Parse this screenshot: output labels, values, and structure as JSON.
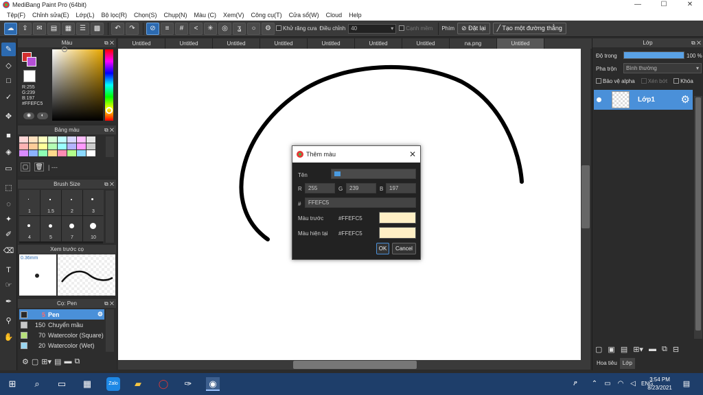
{
  "window": {
    "title": "MediBang Paint Pro (64bit)",
    "minimize": "—",
    "maximize": "☐",
    "close": "✕"
  },
  "menu": [
    "Tệp(F)",
    "Chỉnh sửa(E)",
    "Lớp(L)",
    "Bộ lọc(R)",
    "Chọn(S)",
    "Chụp(N)",
    "Màu (C)",
    "Xem(V)",
    "Công cụ(T)",
    "Cửa sổ(W)",
    "Cloud",
    "Help"
  ],
  "toolbar": {
    "antialias_label": "Khử răng cưa",
    "adjust_label": "Điều chỉnh",
    "adjust_value": "40",
    "edge_label": "Cạnh mềm",
    "key_label": "Phím",
    "reset_label": "Đặt lại",
    "straight_label": "Tạo một đường thẳng"
  },
  "color_panel": {
    "title": "Màu",
    "r": "R:255",
    "g": "G:239",
    "b": "B:197",
    "hex": "#FFEFC5",
    "fg_color": "#d32f2f",
    "bg_color": "#ffffff"
  },
  "palette_panel": {
    "title": "Bảng màu",
    "status": "| ---"
  },
  "palette_colors": [
    "#ffd7d7",
    "#ffe1bf",
    "#ffffbf",
    "#d7ffd7",
    "#bfffff",
    "#d7d7ff",
    "#ffbfff",
    "#e6e6e6",
    "#ffb3b3",
    "#ffcc99",
    "#ffff99",
    "#b3ffb3",
    "#99ffff",
    "#b3b3ff",
    "#ff99ff",
    "#cccccc",
    "#d98cff",
    "#8cb3ff",
    "#8cffb3",
    "#ffd98c",
    "#ff8cb3",
    "#b3ff8c",
    "#8cd9ff",
    "#ffffff"
  ],
  "brush_panel": {
    "title": "Brush Size",
    "sizes": [
      "1",
      "1.5",
      "2",
      "3",
      "4",
      "5",
      "7",
      "10"
    ]
  },
  "preview_panel": {
    "title": "Xem trước cọ",
    "size": "0.36mm"
  },
  "brush_list": {
    "title": "Cọ: Pen",
    "items": [
      {
        "size": "5",
        "name": "Pen",
        "color": "#2a2a2a"
      },
      {
        "size": "150",
        "name": "Chuyển mầu",
        "color": "#c8c8c8"
      },
      {
        "size": "70",
        "name": "Watercolor (Square)",
        "color": "#b7e07a"
      },
      {
        "size": "20",
        "name": "Watercolor (Wet)",
        "color": "#9ad6f0"
      }
    ]
  },
  "tabs": [
    "Untitled",
    "Untitled",
    "Untitled",
    "Untitled",
    "Untitled",
    "Untitled",
    "Untitled",
    "na.png",
    "Untitled"
  ],
  "dialog": {
    "title": "Thêm màu",
    "name_label": "Tên",
    "r_label": "R",
    "r_value": "255",
    "g_label": "G",
    "g_value": "239",
    "b_label": "B",
    "b_value": "197",
    "hex_label": "#",
    "hex_value": "FFEFC5",
    "prev_label": "Màu trước",
    "prev_hex": "#FFEFC5",
    "curr_label": "Màu hiện tại",
    "curr_hex": "#FFEFC5",
    "ok": "OK",
    "cancel": "Cancel"
  },
  "layer_panel": {
    "title": "Lớp",
    "opacity_label": "Độ trong",
    "opacity_value": "100 %",
    "opacity_fraction": 1.0,
    "blend_label": "Pha trộn",
    "blend_value": "Bình thường",
    "protect_alpha": "Bảo vệ alpha",
    "clip": "Xén bớt",
    "lock": "Khóa",
    "layer_name": "Lớp1",
    "bottom_tabs": [
      "Hoa tiêu",
      "Lớp"
    ]
  },
  "taskbar": {
    "time": "3:54 PM",
    "date": "8/23/2021",
    "lang": "ENG"
  }
}
